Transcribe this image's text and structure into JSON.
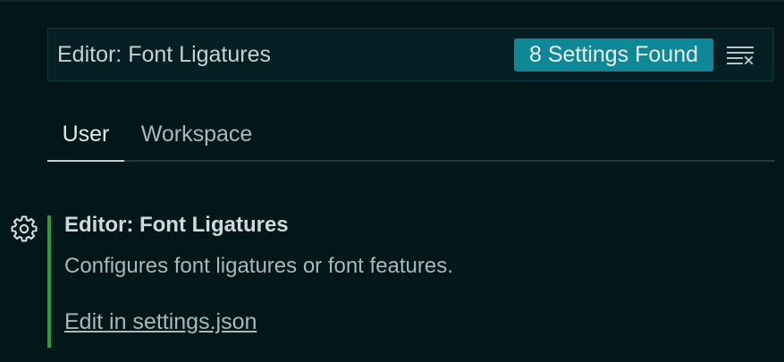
{
  "search": {
    "value": "Editor: Font Ligatures",
    "results_badge": "8 Settings Found",
    "clear_icon": "clear-filter-icon"
  },
  "tabs": [
    {
      "label": "User",
      "active": true
    },
    {
      "label": "Workspace",
      "active": false
    }
  ],
  "setting": {
    "gear_icon": "gear-icon",
    "title": "Editor: Font Ligatures",
    "description": "Configures font ligatures or font features.",
    "edit_link": "Edit in settings.json",
    "modified": true
  },
  "colors": {
    "background": "#03171b",
    "badge": "#0e8797",
    "modified_indicator": "#2a9d37"
  }
}
